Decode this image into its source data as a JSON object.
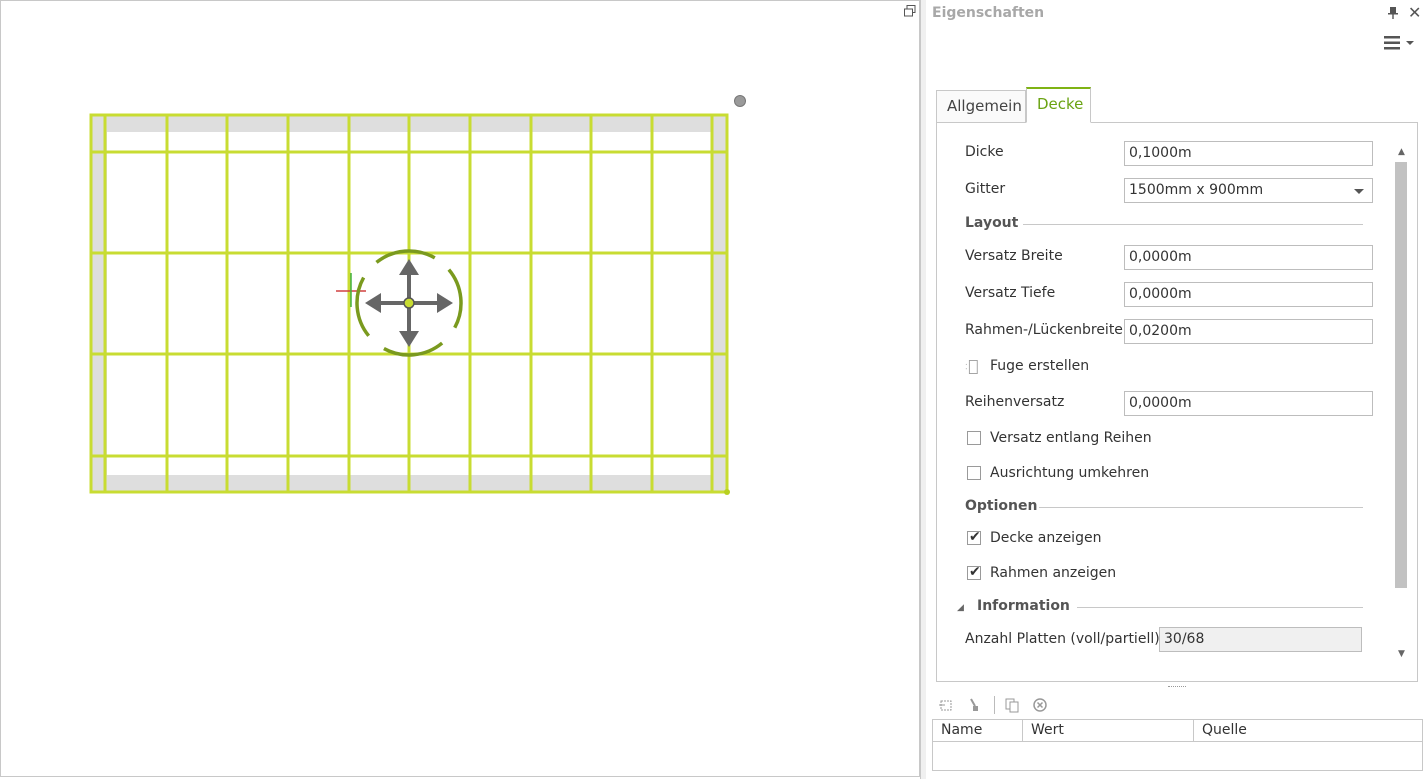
{
  "panel": {
    "title": "Eigenschaften",
    "tabs": [
      "Allgemein",
      "Decke"
    ],
    "active_tab": "Decke",
    "fields": {
      "dicke": {
        "label": "Dicke",
        "value": "0,1000m"
      },
      "gitter": {
        "label": "Gitter",
        "value": "1500mm x 900mm"
      },
      "versatz_breite": {
        "label": "Versatz Breite",
        "value": "0,0000m"
      },
      "versatz_tiefe": {
        "label": "Versatz Tiefe",
        "value": "0,0000m"
      },
      "rahmen": {
        "label": "Rahmen-/Lückenbreite",
        "value": "0,0200m"
      },
      "reihenversatz": {
        "label": "Reihenversatz",
        "value": "0,0000m"
      },
      "anzahl": {
        "label": "Anzahl Platten (voll/partiell)",
        "value": "30/68"
      }
    },
    "sections": {
      "layout": "Layout",
      "optionen": "Optionen",
      "information": "Information"
    },
    "toggles": {
      "fuge": {
        "label": "Fuge erstellen",
        "checked": false
      }
    },
    "checkboxes": {
      "versatz_reihen": {
        "label": "Versatz entlang Reihen",
        "checked": false
      },
      "ausrichtung": {
        "label": "Ausrichtung umkehren",
        "checked": false
      },
      "decke_anzeigen": {
        "label": "Decke anzeigen",
        "checked": true
      },
      "rahmen_anzeigen": {
        "label": "Rahmen anzeigen",
        "checked": true
      }
    },
    "grid_headers": [
      "Name",
      "Wert",
      "Quelle"
    ]
  },
  "colors": {
    "accent": "#7fb314",
    "frame_green": "#c8dc32",
    "gizmo_green": "#7a9a1e",
    "tile_gray": "#dedede"
  }
}
